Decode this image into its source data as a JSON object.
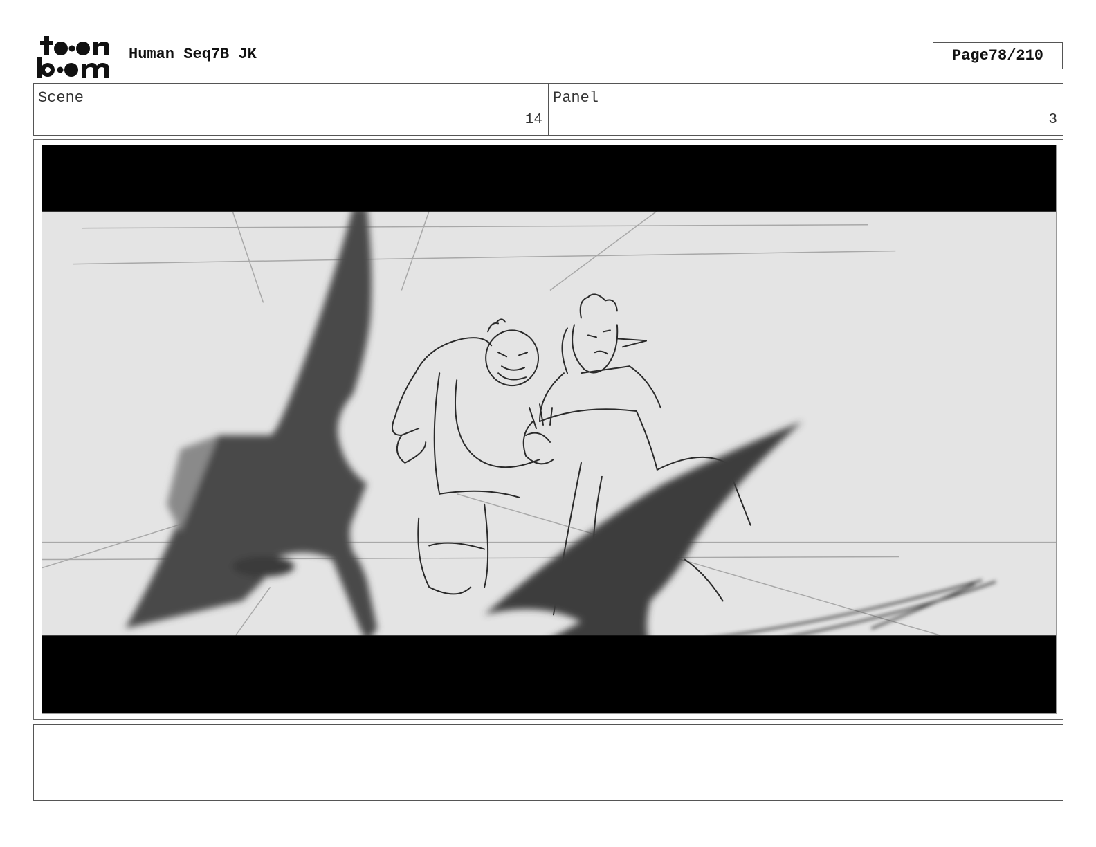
{
  "header": {
    "logo_name": "toon-boom-logo",
    "doc_title": "Human Seq7B JK",
    "page_label": "Page",
    "page_number": "78/210"
  },
  "info": {
    "scene_label": "Scene",
    "scene_value": "14",
    "panel_label": "Panel",
    "panel_value": "3"
  },
  "frame": {
    "description_icon": "storyboard-sketch",
    "letterbox_color": "#000000",
    "background_color": "#e4e4e4"
  },
  "caption": {
    "text": ""
  }
}
